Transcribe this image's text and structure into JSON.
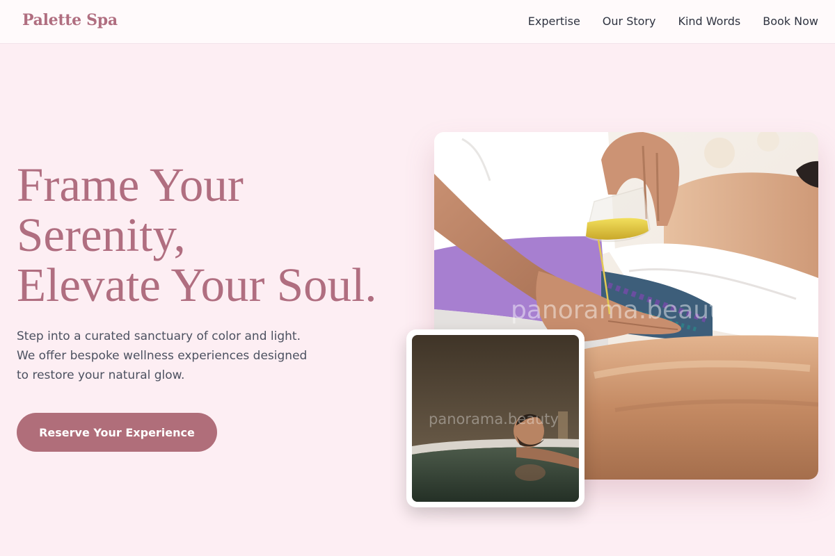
{
  "brand": {
    "name": "Palette Spa"
  },
  "nav": {
    "items": [
      {
        "label": "Expertise"
      },
      {
        "label": "Our Story"
      },
      {
        "label": "Kind Words"
      },
      {
        "label": "Book Now"
      }
    ]
  },
  "hero": {
    "title_lines": [
      "Frame Your",
      "Serenity,",
      "Elevate Your Soul."
    ],
    "description_lines": [
      "Step into a curated sanctuary of color and light.",
      "We offer bespoke wellness experiences designed",
      "to restore your natural glow."
    ],
    "cta_label": "Reserve Your Experience"
  },
  "images": {
    "main_watermark": "panorama.beauty",
    "thumb_watermark": "panorama.beauty"
  },
  "colors": {
    "accent": "#b06e80",
    "button": "#b06e7a",
    "background": "#fdeef3",
    "nav_background": "#fffafb"
  }
}
